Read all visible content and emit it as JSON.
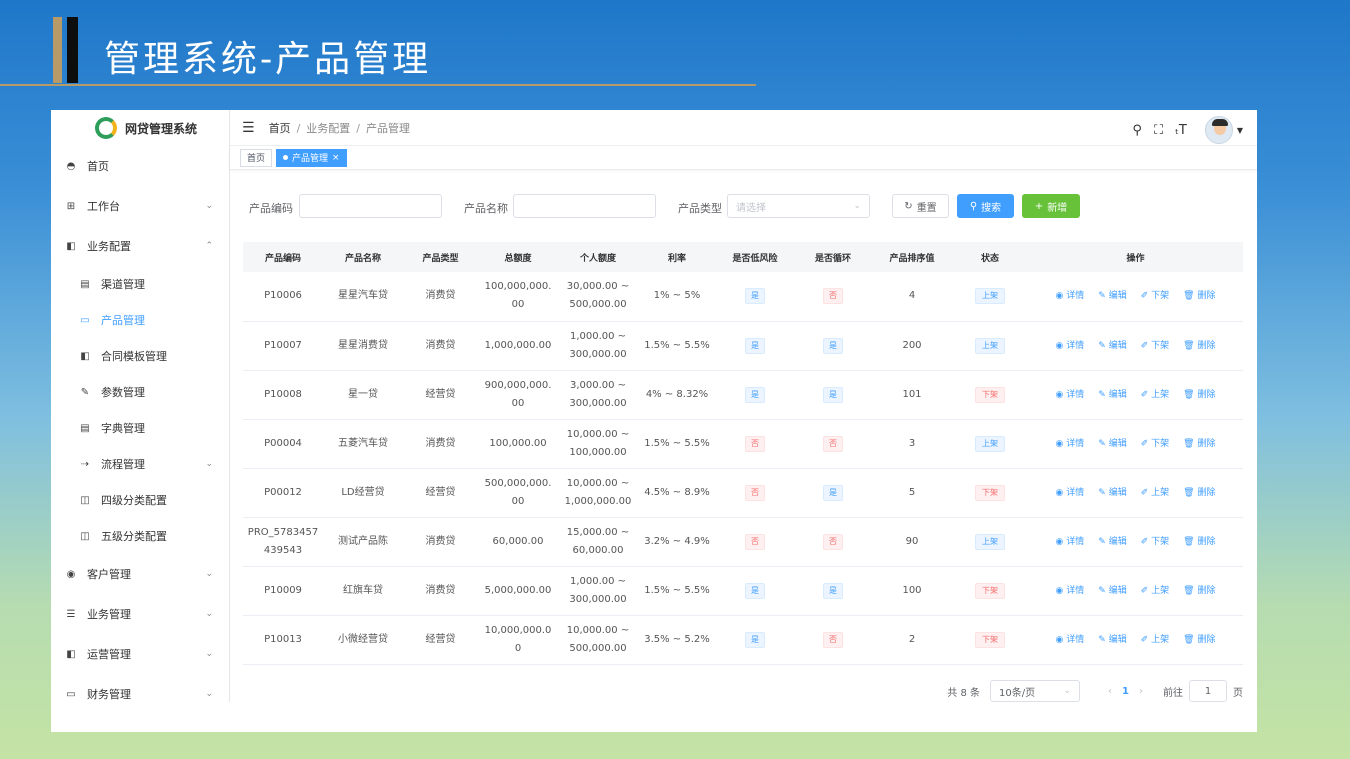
{
  "slide": {
    "title": "管理系统-产品管理"
  },
  "app": {
    "name": "网贷管理系统"
  },
  "sidebar": {
    "items": [
      {
        "label": "首页",
        "icon": "dashboard-icon",
        "glyph": "◓"
      },
      {
        "label": "工作台",
        "icon": "grid-icon",
        "glyph": "⊞",
        "chevron": "⌄"
      },
      {
        "label": "业务配置",
        "icon": "book-icon",
        "glyph": "◧",
        "chevron": "⌃"
      },
      {
        "label": "客户管理",
        "icon": "customer-icon",
        "glyph": "◉",
        "chevron": "⌄"
      },
      {
        "label": "业务管理",
        "icon": "sliders-icon",
        "glyph": "☰",
        "chevron": "⌄"
      },
      {
        "label": "运营管理",
        "icon": "ops-icon",
        "glyph": "◧",
        "chevron": "⌄"
      },
      {
        "label": "财务管理",
        "icon": "monitor-icon",
        "glyph": "▭",
        "chevron": "⌄"
      }
    ],
    "sub_items": [
      {
        "label": "渠道管理",
        "icon": "doc-icon",
        "glyph": "▤"
      },
      {
        "label": "产品管理",
        "icon": "monitor-icon",
        "glyph": "▭"
      },
      {
        "label": "合同模板管理",
        "icon": "book-icon",
        "glyph": "◧"
      },
      {
        "label": "参数管理",
        "icon": "edit-icon",
        "glyph": "✎"
      },
      {
        "label": "字典管理",
        "icon": "dict-icon",
        "glyph": "▤"
      },
      {
        "label": "流程管理",
        "icon": "flow-icon",
        "glyph": "⇢",
        "chevron": "⌄"
      },
      {
        "label": "四级分类配置",
        "icon": "book-open-icon",
        "glyph": "◫"
      },
      {
        "label": "五级分类配置",
        "icon": "book-open-icon",
        "glyph": "◫"
      }
    ]
  },
  "breadcrumb": {
    "home": "首页",
    "level1": "业务配置",
    "level2": "产品管理"
  },
  "tags": {
    "home": "首页",
    "active": "产品管理"
  },
  "filters": {
    "code_label": "产品编码",
    "name_label": "产品名称",
    "type_label": "产品类型",
    "type_placeholder": "请选择",
    "reset": "重置",
    "search": "搜索",
    "add": "新增"
  },
  "table": {
    "headers": [
      "产品编码",
      "产品名称",
      "产品类型",
      "总额度",
      "个人额度",
      "利率",
      "是否低风险",
      "是否循环",
      "产品排序值",
      "状态",
      "操作"
    ],
    "actions": {
      "detail": "详情",
      "edit": "编辑",
      "delete": "删除"
    },
    "rows": [
      {
        "code": "P10006",
        "name": "星星汽车贷",
        "type": "消费贷",
        "total": "100,000,000.00",
        "personal": "30,000.00 ~ 500,000.00",
        "rate": "1% ~ 5%",
        "low_risk": "是",
        "cyclic": "否",
        "sort": "4",
        "status": "上架",
        "toggle": "下架"
      },
      {
        "code": "P10007",
        "name": "星星消费贷",
        "type": "消费贷",
        "total": "1,000,000.00",
        "personal": "1,000.00 ~ 300,000.00",
        "rate": "1.5% ~ 5.5%",
        "low_risk": "是",
        "cyclic": "是",
        "sort": "200",
        "status": "上架",
        "toggle": "下架"
      },
      {
        "code": "P10008",
        "name": "星一贷",
        "type": "经营贷",
        "total": "900,000,000.00",
        "personal": "3,000.00 ~ 300,000.00",
        "rate": "4% ~ 8.32%",
        "low_risk": "是",
        "cyclic": "是",
        "sort": "101",
        "status": "下架",
        "toggle": "上架"
      },
      {
        "code": "P00004",
        "name": "五菱汽车贷",
        "type": "消费贷",
        "total": "100,000.00",
        "personal": "10,000.00 ~ 100,000.00",
        "rate": "1.5% ~ 5.5%",
        "low_risk": "否",
        "cyclic": "否",
        "sort": "3",
        "status": "上架",
        "toggle": "下架"
      },
      {
        "code": "P00012",
        "name": "LD经营贷",
        "type": "经营贷",
        "total": "500,000,000.00",
        "personal": "10,000.00 ~ 1,000,000.00",
        "rate": "4.5% ~ 8.9%",
        "low_risk": "否",
        "cyclic": "是",
        "sort": "5",
        "status": "下架",
        "toggle": "上架"
      },
      {
        "code": "PRO_5783457439543",
        "name": "测试产品陈",
        "type": "消费贷",
        "total": "60,000.00",
        "personal": "15,000.00 ~ 60,000.00",
        "rate": "3.2% ~ 4.9%",
        "low_risk": "否",
        "cyclic": "否",
        "sort": "90",
        "status": "上架",
        "toggle": "下架"
      },
      {
        "code": "P10009",
        "name": "红旗车贷",
        "type": "消费贷",
        "total": "5,000,000.00",
        "personal": "1,000.00 ~ 300,000.00",
        "rate": "1.5% ~ 5.5%",
        "low_risk": "是",
        "cyclic": "是",
        "sort": "100",
        "status": "下架",
        "toggle": "上架"
      },
      {
        "code": "P10013",
        "name": "小微经营贷",
        "type": "经营贷",
        "total": "10,000,000.00",
        "personal": "10,000.00 ~ 500,000.00",
        "rate": "3.5% ~ 5.2%",
        "low_risk": "是",
        "cyclic": "否",
        "sort": "2",
        "status": "下架",
        "toggle": "上架"
      }
    ]
  },
  "pagination": {
    "total": "共 8 条",
    "page_size": "10条/页",
    "current": "1",
    "goto_label": "前往",
    "goto_value": "1",
    "page_unit": "页"
  },
  "colors": {
    "primary": "#409eff",
    "success": "#67c23a",
    "danger": "#f56c6c",
    "accent_gold": "#b89968"
  }
}
